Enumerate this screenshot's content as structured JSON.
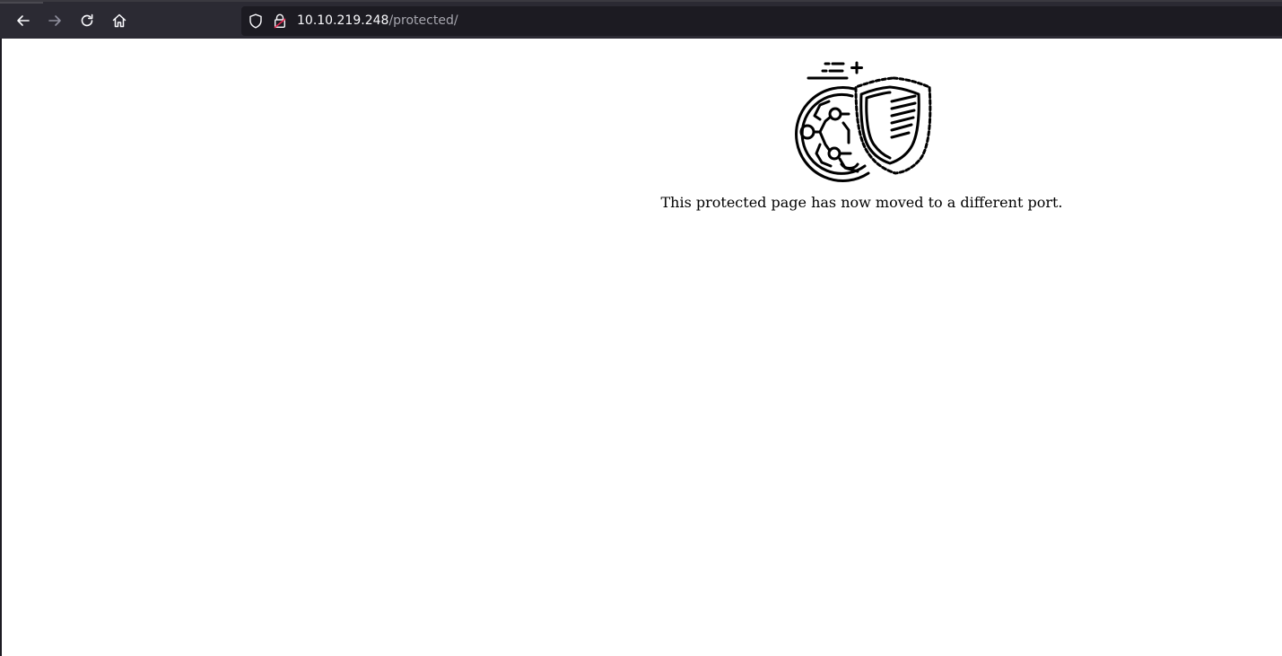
{
  "browser": {
    "nav": {
      "back_icon": "arrow-left-icon",
      "forward_icon": "arrow-right-icon",
      "reload_icon": "reload-icon",
      "home_icon": "home-icon"
    },
    "urlbar": {
      "shield_icon": "tracking-protection-shield-icon",
      "lock_icon": "insecure-lock-icon",
      "host": "10.10.219.248",
      "path": "/protected/"
    },
    "colors": {
      "toolbar": "#2b2a33",
      "urlbar": "#1c1b22",
      "host_text": "#fbfbfe",
      "path_text": "#a6a6ae",
      "insecure_accent": "#e22850"
    }
  },
  "page": {
    "logo_icon": "security-shield-globe-icon",
    "message": "This protected page has now moved to a different port."
  }
}
